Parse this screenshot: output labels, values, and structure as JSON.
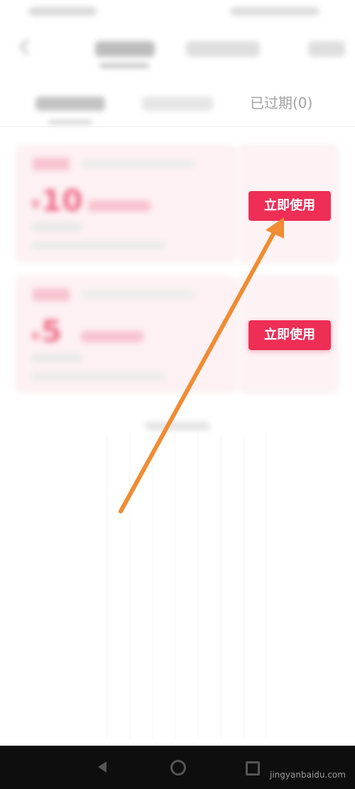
{
  "filter_tabs": {
    "expired_label": "已过期(0)"
  },
  "coupons": [
    {
      "amount": "10",
      "currency": "¥",
      "action_label": "立即使用"
    },
    {
      "amount": "5",
      "currency": "¥",
      "action_label": "立即使用"
    }
  ],
  "watermark": "jingyanbaidu.com",
  "colors": {
    "accent": "#ee2e55",
    "annotation_arrow": "#f08c33",
    "card_bg": "#fdf1f3"
  },
  "icons": [
    "back-arrow-icon",
    "nav-back-icon",
    "nav-home-icon",
    "nav-recent-icon"
  ]
}
